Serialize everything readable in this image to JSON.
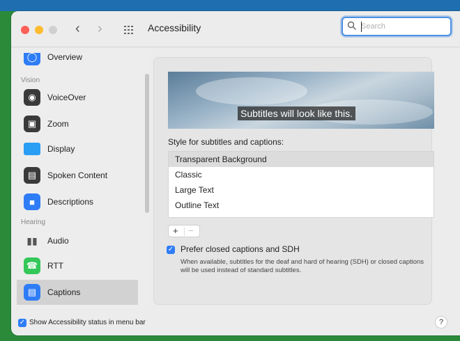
{
  "window": {
    "title": "Accessibility",
    "search_placeholder": "Search"
  },
  "sidebar": {
    "items": [
      {
        "label": "Overview",
        "icon": "overview-icon"
      },
      {
        "label": "VoiceOver",
        "icon": "voiceover-icon"
      },
      {
        "label": "Zoom",
        "icon": "zoom-icon"
      },
      {
        "label": "Display",
        "icon": "display-icon"
      },
      {
        "label": "Spoken Content",
        "icon": "spoken-content-icon"
      },
      {
        "label": "Descriptions",
        "icon": "descriptions-icon"
      },
      {
        "label": "Audio",
        "icon": "audio-icon"
      },
      {
        "label": "RTT",
        "icon": "rtt-icon"
      },
      {
        "label": "Captions",
        "icon": "captions-icon"
      }
    ],
    "sections": {
      "vision": "Vision",
      "hearing": "Hearing"
    },
    "selected": "Captions"
  },
  "captions": {
    "preview_text": "Subtitles will look like this.",
    "style_label": "Style for subtitles and captions:",
    "styles": [
      "Transparent Background",
      "Classic",
      "Large Text",
      "Outline Text"
    ],
    "selected_style": "Transparent Background",
    "add_label": "+",
    "remove_label": "−",
    "prefer_cc_label": "Prefer closed captions and SDH",
    "prefer_cc_checked": true,
    "prefer_cc_description": "When available, subtitles for the deaf and hard of hearing (SDH) or closed captions will be used instead of standard subtitles."
  },
  "footer": {
    "status_menu_label": "Show Accessibility status in menu bar",
    "status_menu_checked": true,
    "help_label": "?"
  },
  "colors": {
    "accent": "#2f7df6",
    "desktop": "#2a8a3a"
  }
}
